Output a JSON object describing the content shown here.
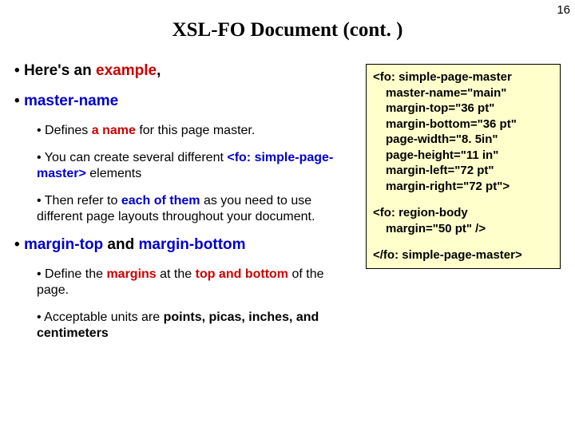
{
  "page_number": "16",
  "title": "XSL-FO Document (cont. )",
  "b1_example_pre": "Here's an ",
  "b1_example_em": "example",
  "b1_example_post": ",",
  "b1_mastername": "master-name",
  "b2_defines_pre": "Defines ",
  "b2_defines_em": "a name",
  "b2_defines_post": " for this page master.",
  "b2_several_pre": "You can create several different ",
  "b2_several_em": "<fo: simple-page-master>",
  "b2_several_post": " elements",
  "b2_refer_pre": "Then refer to ",
  "b2_refer_em": "each of them",
  "b2_refer_post": " as you need to use different page layouts throughout your document.",
  "b1_margins_pre": "margin-top",
  "b1_margins_mid": " and ",
  "b1_margins_post": "margin-bottom",
  "b2_define_margins_pre": "Define the ",
  "b2_define_margins_em1": "margins",
  "b2_define_margins_mid": " at the ",
  "b2_define_margins_em2": "top and bottom",
  "b2_define_margins_post": " of the page.",
  "b2_units_pre": "Acceptable units are ",
  "b2_units_em": "points, picas, inches, and centimeters",
  "code_l1": "<fo: simple-page-master",
  "code_l2": "master-name=\"main\"",
  "code_l3": "margin-top=\"36 pt\"",
  "code_l4": "margin-bottom=\"36 pt\"",
  "code_l5": "page-width=\"8. 5in\"",
  "code_l6": "page-height=\"11 in\"",
  "code_l7": "margin-left=\"72 pt\"",
  "code_l8": "margin-right=\"72 pt\">",
  "code_l9": "<fo: region-body",
  "code_l10": "margin=\"50 pt\" />",
  "code_l11": "</fo: simple-page-master>"
}
